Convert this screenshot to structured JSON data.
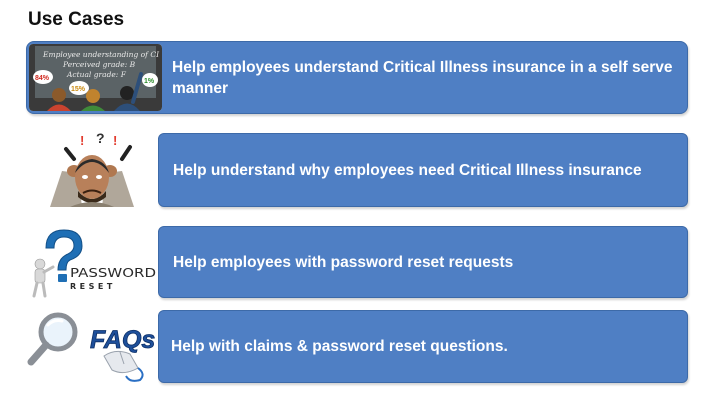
{
  "page": {
    "title": "Use Cases"
  },
  "use_cases": [
    {
      "label": "Help employees understand Critical Illness insurance in a self serve manner",
      "image": {
        "icon": "classroom-chalkboard-icon",
        "chalk_lines": [
          "Employee understanding of CI",
          "Perceived grade: B",
          "Actual grade: F"
        ],
        "bubbles": [
          "84%",
          "15%",
          "1%"
        ]
      }
    },
    {
      "label": "Help understand why employees need Critical Illness insurance",
      "image": {
        "icon": "confused-person-icon"
      }
    },
    {
      "label": "Help employees with password reset requests",
      "image": {
        "icon": "password-reset-icon",
        "word1": "PASSWORD",
        "word2": "RESET"
      }
    },
    {
      "label": "Help with claims & password reset questions.",
      "image": {
        "icon": "faq-magnifier-icon",
        "word": "FAQs"
      }
    }
  ],
  "colors": {
    "bar": "#4f7fc4",
    "bar_border": "#3d6aa8",
    "text": "#ffffff",
    "title": "#111111"
  }
}
